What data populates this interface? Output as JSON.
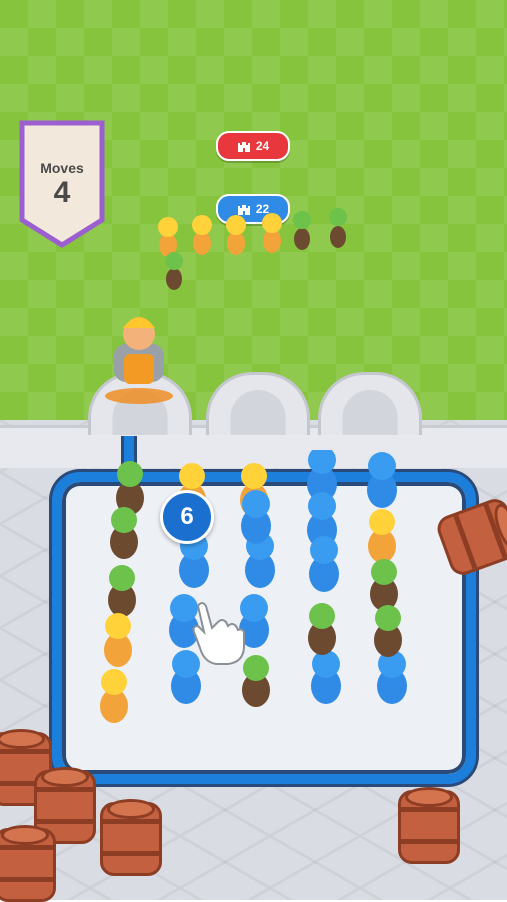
{
  "hud": {
    "moves_label": "Moves",
    "moves_value": "4",
    "enemy_count": "24",
    "player_count": "22",
    "selected_count": "6"
  },
  "colors": {
    "grass": "#86c43e",
    "board_border": "#1c7fdc",
    "enemy_badge": "#e8383d",
    "player_badge": "#2f8be6",
    "banner_border": "#9b5fcf"
  },
  "icons": {
    "castle": "castle-icon",
    "hand": "tap-hand-icon"
  }
}
